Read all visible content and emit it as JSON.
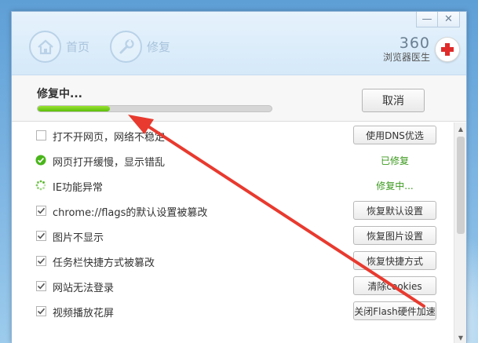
{
  "window": {
    "controls": {
      "minimize": "—",
      "close": "✕"
    }
  },
  "nav": {
    "items": [
      {
        "label": "首页",
        "icon": "home-icon"
      },
      {
        "label": "修复",
        "icon": "wrench-icon"
      }
    ]
  },
  "brand": {
    "number": "360",
    "name": "浏览器医生",
    "icon": "red-cross-icon"
  },
  "progress": {
    "title": "修复中...",
    "value_percent": 31,
    "cancel_label": "取消"
  },
  "colors": {
    "accent_green": "#5cbf0b",
    "status_green": "#3c9a1e",
    "annotation_red": "#e83a2f"
  },
  "list": {
    "rows": [
      {
        "type": "checkbox",
        "label": "打不开网页，网络不稳定",
        "action": "使用DNS优选"
      },
      {
        "type": "done",
        "label": "网页打开缓慢，显示错乱",
        "status": "已修复"
      },
      {
        "type": "loading",
        "label": "IE功能异常",
        "status": "修复中..."
      },
      {
        "type": "checked",
        "label": "chrome://flags的默认设置被篡改",
        "action": "恢复默认设置"
      },
      {
        "type": "checked",
        "label": "图片不显示",
        "action": "恢复图片设置"
      },
      {
        "type": "checked",
        "label": "任务栏快捷方式被篡改",
        "action": "恢复快捷方式"
      },
      {
        "type": "checked",
        "label": "网站无法登录",
        "action": "清除cookies"
      },
      {
        "type": "checked",
        "label": "视频播放花屏",
        "action": "关闭Flash硬件加速"
      }
    ]
  },
  "scrollbar": {
    "up": "▲",
    "down": "▼"
  }
}
